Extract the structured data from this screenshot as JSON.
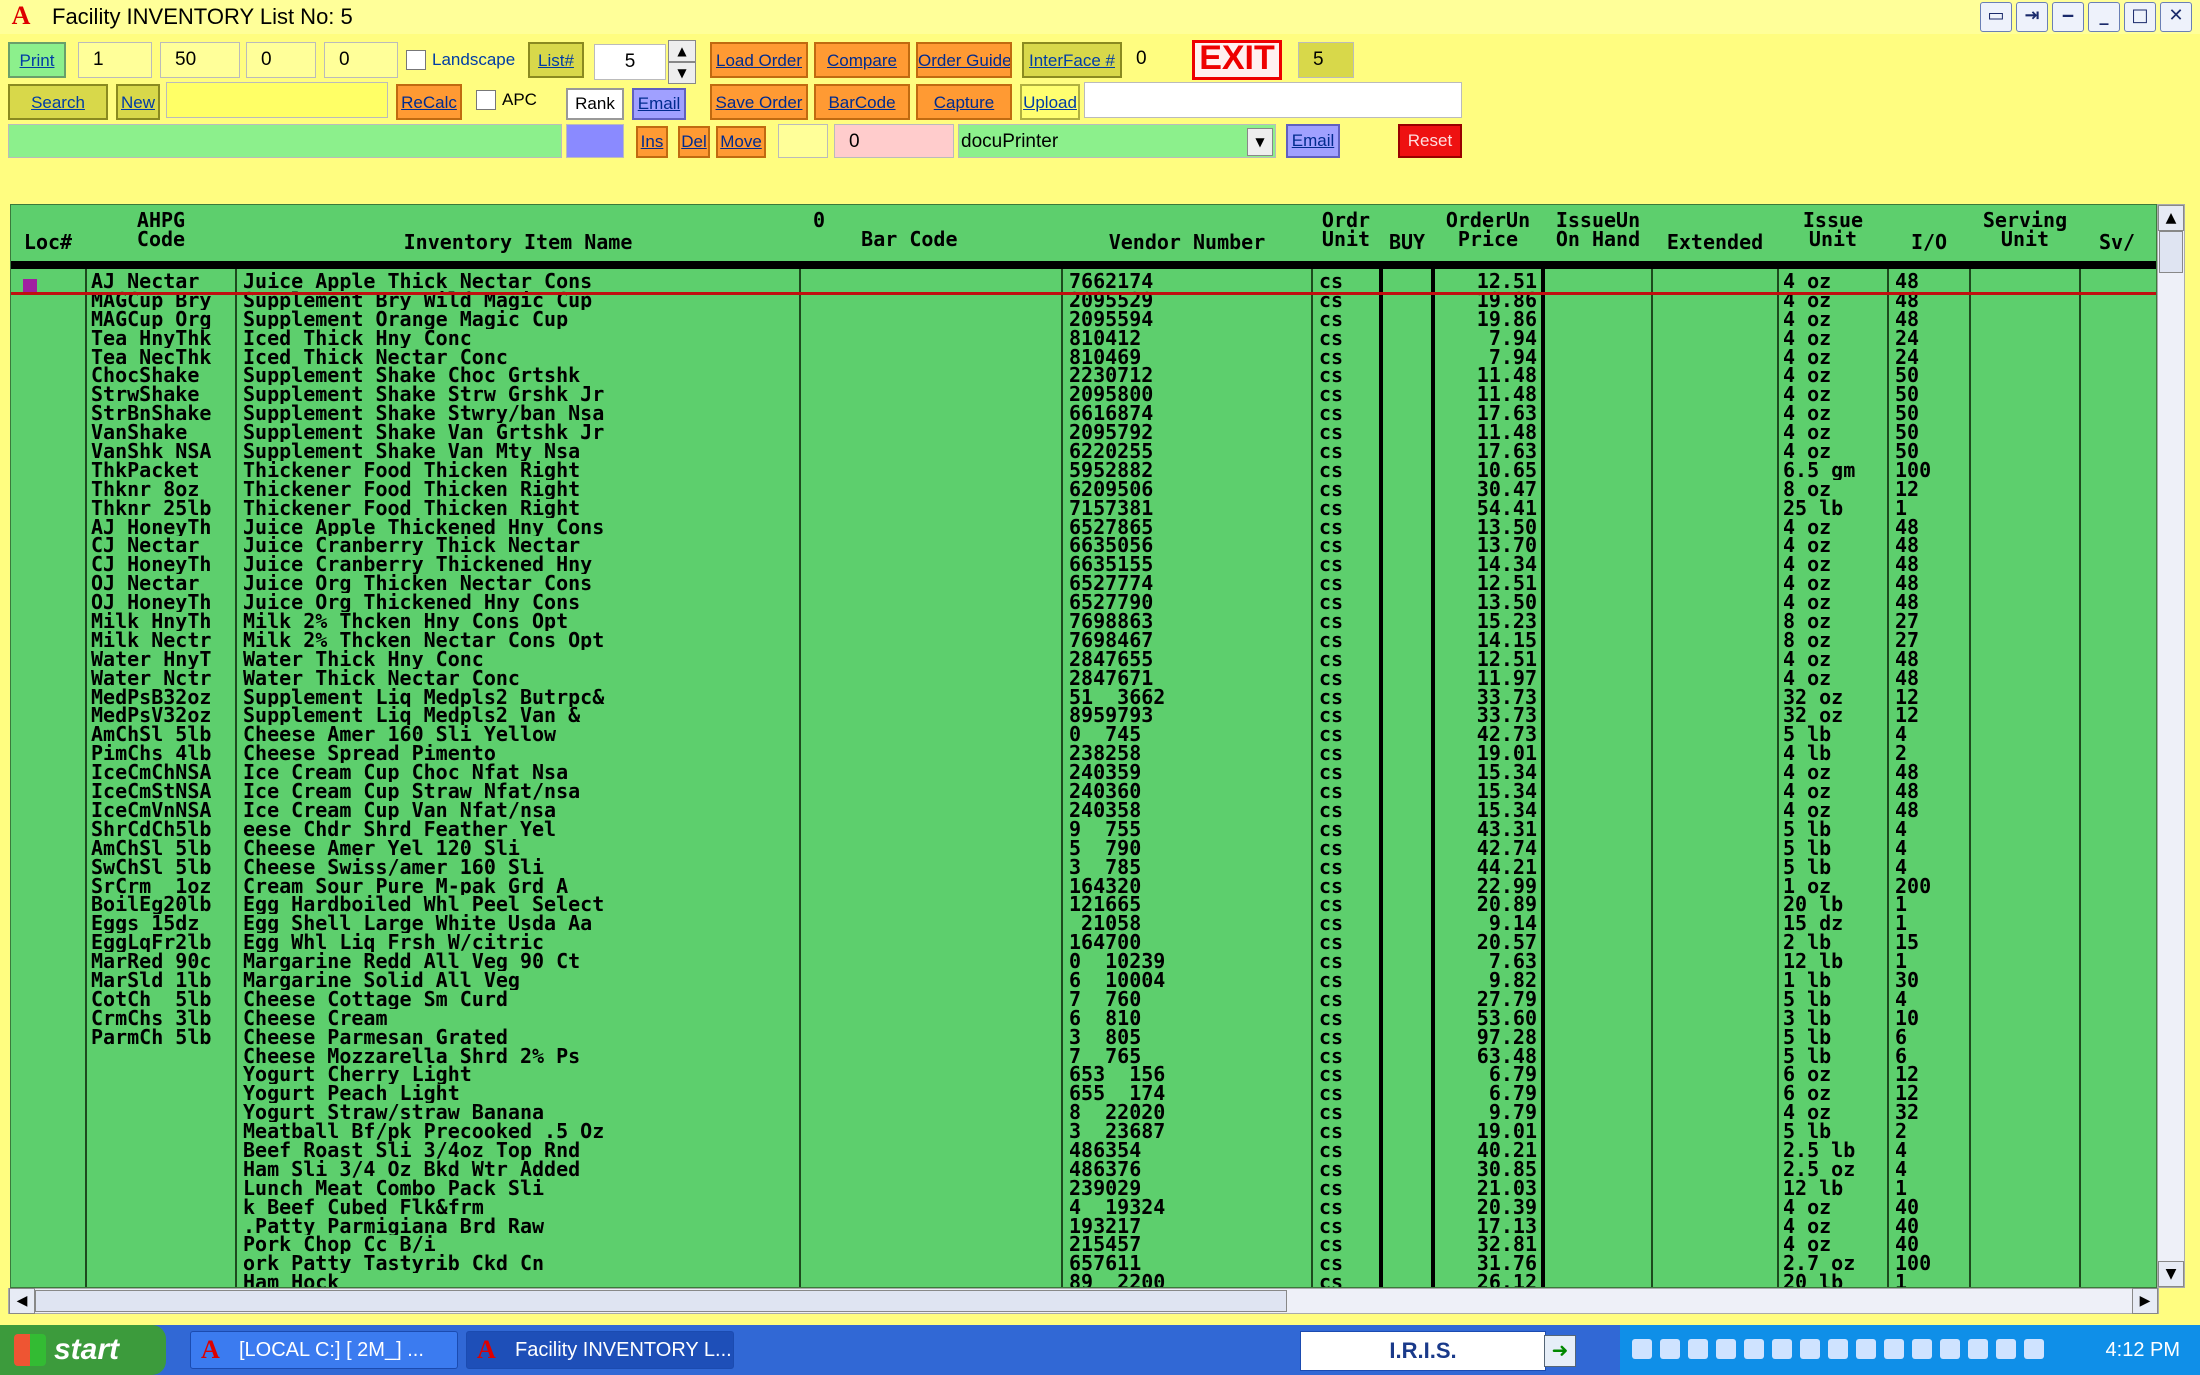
{
  "window": {
    "title": "Facility INVENTORY List No: 5",
    "app_icon": "A"
  },
  "toolbar": {
    "print": "Print",
    "field1": "1",
    "field2": "50",
    "field3": "0",
    "field4": "0",
    "landscape": "Landscape",
    "list_btn": "List#",
    "list_value": "5",
    "load_order": "Load Order",
    "compare": "Compare",
    "order_guide": "Order Guide",
    "interface": "InterFace #",
    "interface_value": "0",
    "exit": "EXIT",
    "exit_value": "5",
    "search": "Search",
    "new": "New",
    "recalc": "ReCalc",
    "apc": "APC",
    "rank": "Rank",
    "email": "Email",
    "save_order": "Save Order",
    "barcode": "BarCode",
    "capture": "Capture",
    "upload": "Upload",
    "ins": "Ins",
    "del": "Del",
    "move": "Move",
    "amount": "0",
    "printer": "docuPrinter",
    "email2": "Email",
    "reset": "Reset"
  },
  "grid": {
    "headers": {
      "loc": "Loc#",
      "ahpg": "AHPG\nCode",
      "name": "Inventory Item Name",
      "barcode": "0\n    Bar Code",
      "vendor": "Vendor Number",
      "ordr": "Ordr\nUnit",
      "buy": "BUY",
      "price": "OrderUn\nPrice",
      "issueun": "IssueUn\nOn Hand",
      "extended": "Extended",
      "issue": "Issue\nUnit",
      "io": "I/O",
      "serving": "Serving\nUnit",
      "sv": "Sv/"
    },
    "rows": [
      [
        "AJ Nectar",
        "Juice Apple Thick Nectar Cons",
        "7662174",
        "cs",
        "12.51",
        "4 oz",
        "48"
      ],
      [
        "MAGCup Bry",
        "Supplement Bry Wild Magic Cup",
        "2095529",
        "cs",
        "19.86",
        "4 oz",
        "48"
      ],
      [
        "MAGCup Org",
        "Supplement Orange Magic Cup",
        "2095594",
        "cs",
        "19.86",
        "4 oz",
        "48"
      ],
      [
        "Tea HnyThk",
        "Iced Thick Hny Conc",
        "810412",
        "cs",
        "7.94",
        "4 oz",
        "24"
      ],
      [
        "Tea NecThk",
        "Iced Thick Nectar Conc",
        "810469",
        "cs",
        "7.94",
        "4 oz",
        "24"
      ],
      [
        "ChocShake",
        "Supplement Shake Choc Grtshk",
        "2230712",
        "cs",
        "11.48",
        "4 oz",
        "50"
      ],
      [
        "StrwShake",
        "Supplement Shake Strw Grshk Jr",
        "2095800",
        "cs",
        "11.48",
        "4 oz",
        "50"
      ],
      [
        "StrBnShake",
        "Supplement Shake Stwry/ban Nsa",
        "6616874",
        "cs",
        "17.63",
        "4 oz",
        "50"
      ],
      [
        "VanShake",
        "Supplement Shake Van Grtshk Jr",
        "2095792",
        "cs",
        "11.48",
        "4 oz",
        "50"
      ],
      [
        "VanShk NSA",
        "Supplement Shake Van Mty Nsa",
        "6220255",
        "cs",
        "17.63",
        "4 oz",
        "50"
      ],
      [
        "ThkPacket",
        "Thickener Food Thicken Right",
        "5952882",
        "cs",
        "10.65",
        "6.5 gm",
        "100"
      ],
      [
        "Thknr 8oz",
        "Thickener Food Thicken Right",
        "6209506",
        "cs",
        "30.47",
        "8 oz",
        "12"
      ],
      [
        "Thknr 25lb",
        "Thickener Food Thicken Right",
        "7157381",
        "cs",
        "54.41",
        "25 lb",
        "1"
      ],
      [
        "AJ HoneyTh",
        "Juice Apple Thickened Hny Cons",
        "6527865",
        "cs",
        "13.50",
        "4 oz",
        "48"
      ],
      [
        "CJ Nectar",
        "Juice Cranberry Thick Nectar",
        "6635056",
        "cs",
        "13.70",
        "4 oz",
        "48"
      ],
      [
        "CJ HoneyTh",
        "Juice Cranberry Thickened Hny",
        "6635155",
        "cs",
        "14.34",
        "4 oz",
        "48"
      ],
      [
        "OJ Nectar",
        "Juice Org Thicken Nectar Cons",
        "6527774",
        "cs",
        "12.51",
        "4 oz",
        "48"
      ],
      [
        "OJ HoneyTh",
        "Juice Org Thickened Hny Cons",
        "6527790",
        "cs",
        "13.50",
        "4 oz",
        "48"
      ],
      [
        "Milk HnyTh",
        "Milk 2% Thcken Hny Cons Opt",
        "7698863",
        "cs",
        "15.23",
        "8 oz",
        "27"
      ],
      [
        "Milk Nectr",
        "Milk 2% Thcken Nectar Cons Opt",
        "7698467",
        "cs",
        "14.15",
        "8 oz",
        "27"
      ],
      [
        "Water HnyT",
        "Water Thick Hny Conc",
        "2847655",
        "cs",
        "12.51",
        "4 oz",
        "48"
      ],
      [
        "Water Nctr",
        "Water Thick Nectar Conc",
        "2847671",
        "cs",
        "11.97",
        "4 oz",
        "48"
      ],
      [
        "MedPsB32oz",
        "Supplement Liq Medpls2 Butrpc&",
        "51  3662",
        "cs",
        "33.73",
        "32 oz",
        "12"
      ],
      [
        "MedPsV32oz",
        "Supplement Liq Medpls2 Van &",
        "8959793",
        "cs",
        "33.73",
        "32 oz",
        "12"
      ],
      [
        "AmChSl 5lb",
        "Cheese Amer 160 Sli Yellow",
        "0  745",
        "cs",
        "42.73",
        "5 lb",
        "4"
      ],
      [
        "PimChs 4lb",
        "Cheese Spread Pimento",
        "238258",
        "cs",
        "19.01",
        "4 lb",
        "2"
      ],
      [
        "IceCmChNSA",
        "Ice Cream Cup Choc Nfat Nsa",
        "240359",
        "cs",
        "15.34",
        "4 oz",
        "48"
      ],
      [
        "IceCmStNSA",
        "Ice Cream Cup Straw Nfat/nsa",
        "240360",
        "cs",
        "15.34",
        "4 oz",
        "48"
      ],
      [
        "IceCmVnNSA",
        "Ice Cream Cup Van Nfat/nsa",
        "240358",
        "cs",
        "15.34",
        "4 oz",
        "48"
      ],
      [
        "ShrCdCh5lb",
        "eese Chdr Shrd Feather Yel",
        "9  755",
        "cs",
        "43.31",
        "5 lb",
        "4"
      ],
      [
        "AmChSl 5lb",
        "Cheese Amer Yel 120 Sli",
        "5  790",
        "cs",
        "42.74",
        "5 lb",
        "4"
      ],
      [
        "SwChSl 5lb",
        "Cheese Swiss/amer 160 Sli",
        "3  785",
        "cs",
        "44.21",
        "5 lb",
        "4"
      ],
      [
        "SrCrm  1oz",
        "Cream Sour Pure M-pak Grd A",
        "164320",
        "cs",
        "22.99",
        "1 oz",
        "200"
      ],
      [
        "BoilEg20lb",
        "Egg Hardboiled Whl Peel Select",
        "121665",
        "cs",
        "20.89",
        "20 lb",
        "1"
      ],
      [
        "Eggs 15dz",
        "Egg Shell Large White Usda Aa",
        " 21058",
        "cs",
        "9.14",
        "15 dz",
        "1"
      ],
      [
        "EggLqFr2lb",
        "Egg Whl Liq Frsh W/citric",
        "164700",
        "cs",
        "20.57",
        "2 lb",
        "15"
      ],
      [
        "MarRed 90c",
        "Margarine Redd All Veg 90 Ct",
        "0  10239",
        "cs",
        "7.63",
        "12 lb",
        "1"
      ],
      [
        "MarSld 1lb",
        "Margarine Solid All Veg",
        "6  10004",
        "cs",
        "9.82",
        "1 lb",
        "30"
      ],
      [
        "CotCh  5lb",
        "Cheese Cottage Sm Curd",
        "7  760",
        "cs",
        "27.79",
        "5 lb",
        "4"
      ],
      [
        "CrmChs 3lb",
        "Cheese Cream",
        "6  810",
        "cs",
        "53.60",
        "3 lb",
        "10"
      ],
      [
        "ParmCh 5lb",
        "Cheese Parmesan Grated",
        "3  805",
        "cs",
        "97.28",
        "5 lb",
        "6"
      ],
      [
        "",
        "Cheese Mozzarella Shrd 2% Ps",
        "7  765",
        "cs",
        "63.48",
        "5 lb",
        "6"
      ],
      [
        "",
        "Yogurt Cherry Light",
        "653  156",
        "cs",
        "6.79",
        "6 oz",
        "12"
      ],
      [
        "",
        "Yogurt Peach Light",
        "655  174",
        "cs",
        "6.79",
        "6 oz",
        "12"
      ],
      [
        "",
        "Yogurt Straw/straw Banana",
        "8  22020",
        "cs",
        "9.79",
        "4 oz",
        "32"
      ],
      [
        "",
        "Meatball Bf/pk Precooked .5 Oz",
        "3  23687",
        "cs",
        "19.01",
        "5 lb",
        "2"
      ],
      [
        "",
        "Beef Roast Sli 3/4oz Top Rnd",
        "486354",
        "cs",
        "40.21",
        "2.5 lb",
        "4"
      ],
      [
        "",
        "Ham Sli 3/4 Oz Bkd Wtr Added",
        "486376",
        "cs",
        "30.85",
        "2.5 oz",
        "4"
      ],
      [
        "",
        "Lunch Meat Combo Pack Sli",
        "239029",
        "cs",
        "21.03",
        "12 lb",
        "1"
      ],
      [
        "",
        "k Beef Cubed Flk&frm",
        "4  19324",
        "cs",
        "20.39",
        "4 oz",
        "40"
      ],
      [
        "",
        ".Patty Parmigiana Brd Raw",
        "193217",
        "cs",
        "17.13",
        "4 oz",
        "40"
      ],
      [
        "",
        "Pork Chop Cc B/i",
        "215457",
        "cs",
        "32.81",
        "4 oz",
        "40"
      ],
      [
        "",
        "ork Patty Tastyrib Ckd Cn",
        "657611",
        "cs",
        "31.76",
        "2.7 oz",
        "100"
      ],
      [
        "",
        "Ham Hock",
        "89  2200",
        "cs",
        "26.12",
        "20 lb",
        "1"
      ]
    ]
  },
  "taskbar": {
    "start": "start",
    "task1": "[LOCAL C:] [ 2M_] ...",
    "task2": "Facility INVENTORY L...",
    "iris": "I.R.I.S.",
    "clock": "4:12 PM"
  }
}
